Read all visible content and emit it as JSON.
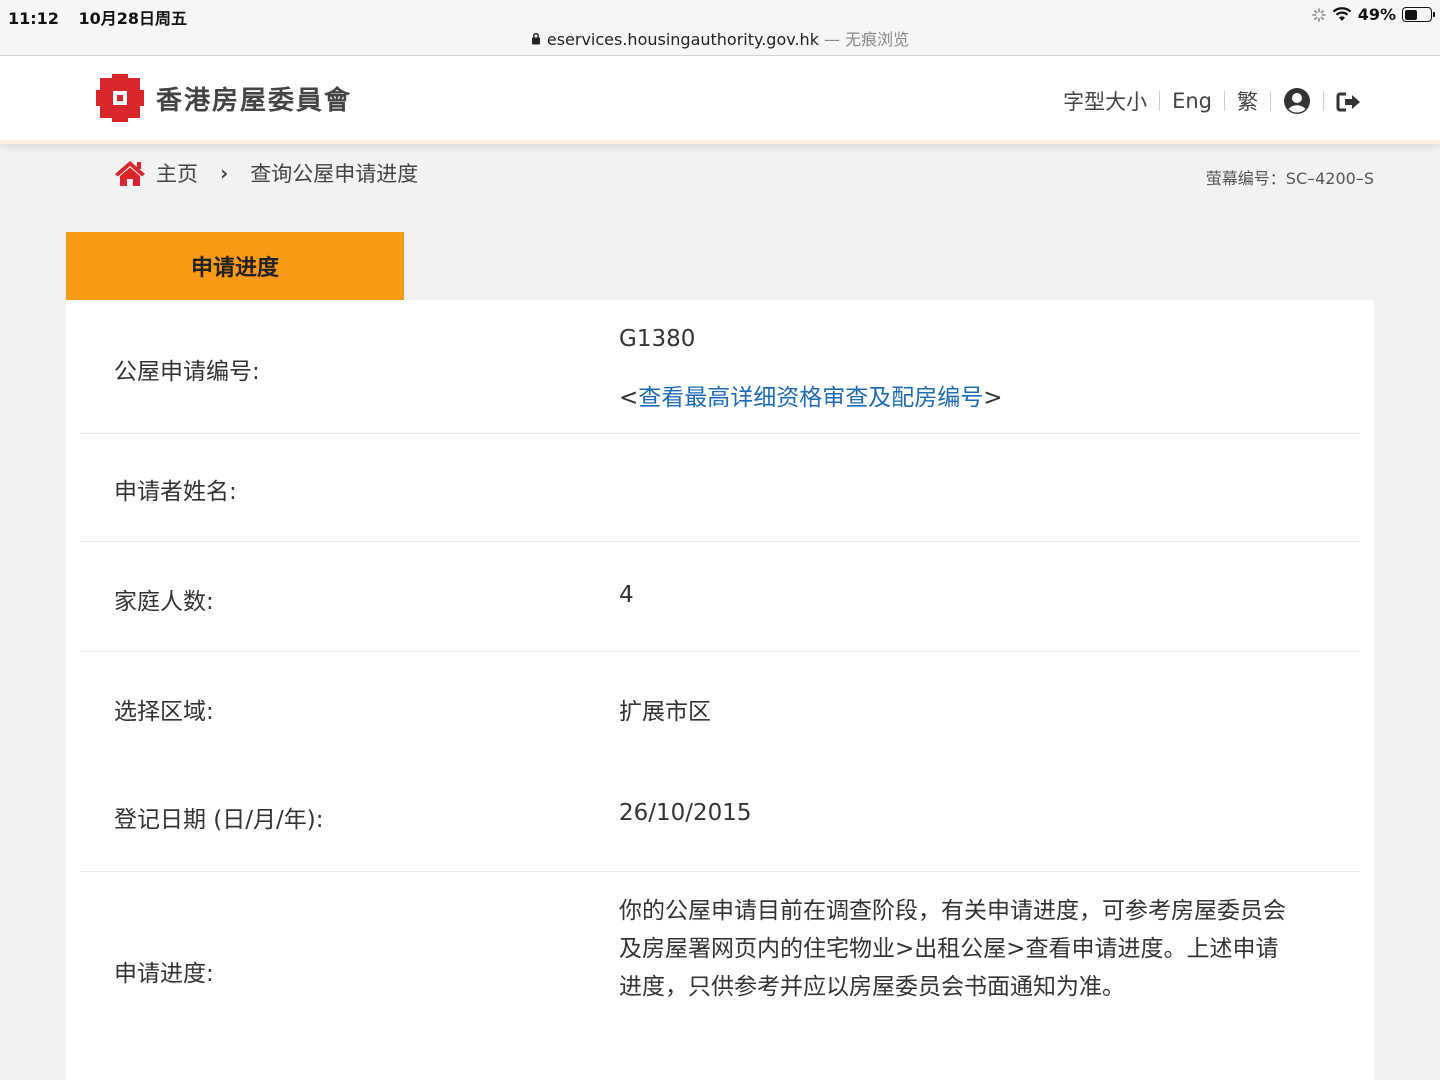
{
  "status_bar": {
    "time": "11:12",
    "date": "10月28日周五",
    "battery": "49%",
    "battery_level": 0.49
  },
  "url_bar": {
    "domain": "eservices.housingauthority.gov.hk",
    "private_label": "— 无痕浏览"
  },
  "header": {
    "logo_text": "香港房屋委員會",
    "font_size_label": "字型大小",
    "english_label": "Eng",
    "traditional_label": "繁"
  },
  "breadcrumb": {
    "home": "主页",
    "current": "查询公屋申请进度"
  },
  "screen_number": "萤幕编号：SC–4200–S",
  "tab": {
    "label": "申请进度"
  },
  "details": {
    "application_no_label": "公屋申请编号:",
    "application_no_value": "G1380",
    "detail_link_open": "<",
    "detail_link_text": "查看最高详细资格审查及配房编号",
    "detail_link_close": ">",
    "applicant_name_label": "申请者姓名:",
    "applicant_name_value": "",
    "household_size_label": "家庭人数:",
    "household_size_value": "4",
    "district_label": "选择区域:",
    "district_value": "扩展市区",
    "registration_date_label": "登记日期 (日/月/年):",
    "registration_date_value": "26/10/2015",
    "progress_label": "申请进度:",
    "progress_value": "你的公屋申请目前在调查阶段，有关申请进度，可参考房屋委员会及房屋署网页内的住宅物业>出租公屋>查看申请进度。上述申请进度，只供参考并应以房屋委员会书面通知为准。"
  }
}
